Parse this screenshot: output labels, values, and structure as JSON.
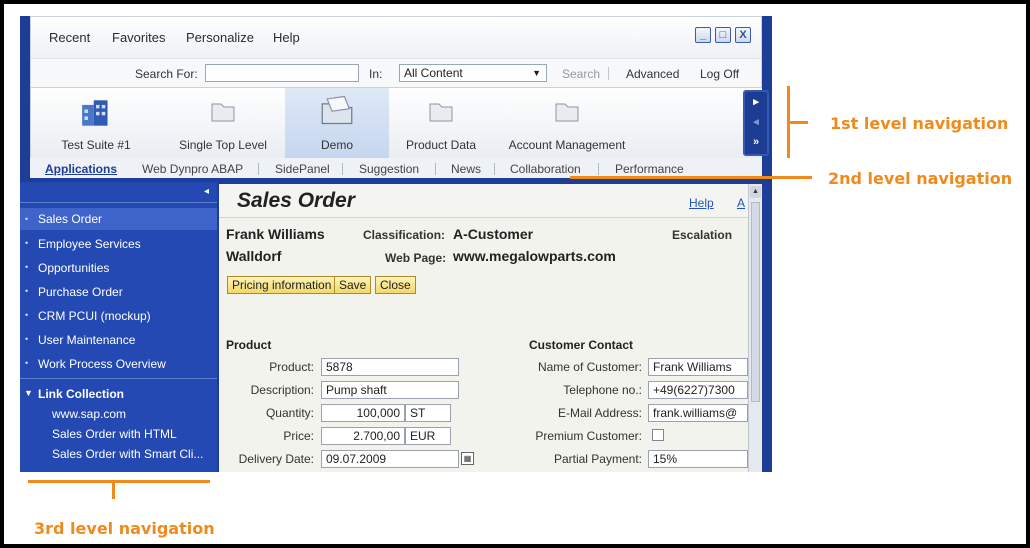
{
  "menu": {
    "items": [
      "Recent",
      "Favorites",
      "Personalize",
      "Help"
    ],
    "window_buttons": [
      "_",
      "□",
      "X"
    ]
  },
  "search": {
    "label": "Search For:",
    "value": "",
    "in_label": "In:",
    "in_value": "All Content",
    "search_link": "Search",
    "advanced_link": "Advanced",
    "logoff_link": "Log Off"
  },
  "level1": {
    "tabs": [
      {
        "label": "Test Suite #1",
        "icon": "building-icon"
      },
      {
        "label": "Single Top Level",
        "icon": "folder-icon"
      },
      {
        "label": "Demo",
        "icon": "open-folder-icon"
      },
      {
        "label": "Product Data",
        "icon": "folder-icon"
      },
      {
        "label": "Account Management",
        "icon": "folder-icon"
      }
    ],
    "selected": "Demo",
    "nav": [
      "▸",
      "◂",
      "»"
    ]
  },
  "level2": {
    "tabs": [
      "Applications",
      "Web Dynpro ABAP",
      "SidePanel",
      "Suggestion",
      "News",
      "Collaboration",
      "Performance"
    ],
    "selected": "Applications"
  },
  "sidebar": {
    "collapse": "◂",
    "items": [
      "Sales Order",
      "Employee Services",
      "Opportunities",
      "Purchase Order",
      "CRM PCUI (mockup)",
      "User Maintenance",
      "Work Process Overview"
    ],
    "selected": "Sales Order",
    "link_collection": {
      "title": "Link Collection",
      "links": [
        "www.sap.com",
        "Sales Order with HTML",
        "Sales Order with Smart Cli..."
      ]
    }
  },
  "content": {
    "title": "Sales Order",
    "help_link": "Help",
    "help_link_2": "A",
    "customer_name": "Frank Williams",
    "city": "Walldorf",
    "classification_label": "Classification:",
    "classification_value": "A-Customer",
    "webpage_label": "Web Page:",
    "webpage_value": "www.megalowparts.com",
    "escalation_label": "Escalation",
    "buttons": [
      "Pricing information",
      "Save",
      "Close"
    ],
    "product_section": "Product",
    "product_fields": [
      {
        "label": "Product:",
        "value": "5878"
      },
      {
        "label": "Description:",
        "value": "Pump shaft"
      },
      {
        "label": "Quantity:",
        "value": "100,000",
        "unit": "ST"
      },
      {
        "label": "Price:",
        "value": "2.700,00",
        "unit": "EUR"
      },
      {
        "label": "Delivery Date:",
        "value": "09.07.2009"
      }
    ],
    "contact_section": "Customer Contact",
    "contact_fields": [
      {
        "label": "Name of Customer:",
        "value": "Frank Williams"
      },
      {
        "label": "Telephone no.:",
        "value": "+49(6227)7300"
      },
      {
        "label": "E-Mail Address:",
        "value": "frank.williams@"
      },
      {
        "label": "Premium Customer:",
        "value": ""
      },
      {
        "label": "Partial Payment:",
        "value": "15%"
      }
    ]
  },
  "annotations": {
    "first": "1st level navigation",
    "second": "2nd level navigation",
    "third": "3rd level navigation",
    "color": "#f08a1b"
  },
  "colors": {
    "frame_blue": "#1e3d97",
    "nav_blue": "#2549b2",
    "button_yellow": "#f3d768"
  }
}
